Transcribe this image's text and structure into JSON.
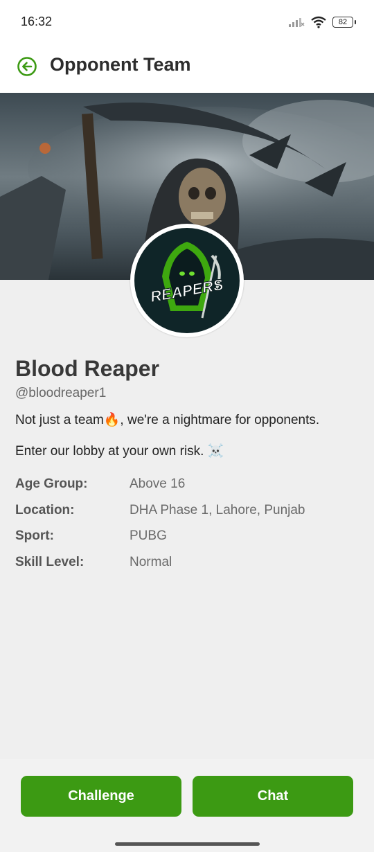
{
  "status_bar": {
    "time": "16:32",
    "battery": "82"
  },
  "header": {
    "title": "Opponent Team"
  },
  "team": {
    "name": "Blood Reaper",
    "handle": "@bloodreaper1",
    "bio_line1": "Not just a team🔥, we're a nightmare for opponents.",
    "bio_line2": "Enter our lobby at your own risk. ☠️",
    "logo_text": "REAPERS"
  },
  "details": [
    {
      "label": "Age Group:",
      "value": "Above 16"
    },
    {
      "label": "Location:",
      "value": "DHA Phase 1, Lahore, Punjab"
    },
    {
      "label": "Sport:",
      "value": "PUBG"
    },
    {
      "label": "Skill Level:",
      "value": "Normal"
    }
  ],
  "actions": {
    "challenge": "Challenge",
    "chat": "Chat"
  },
  "colors": {
    "accent": "#3c9a13",
    "background": "#efefef"
  }
}
